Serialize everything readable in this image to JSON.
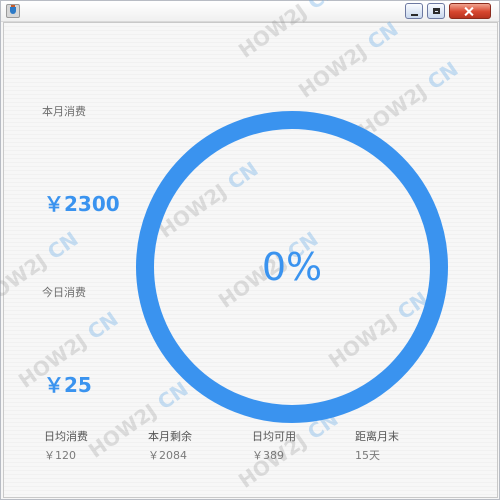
{
  "window": {
    "buttons": {
      "minimize": "minimize",
      "maximize": "maximize",
      "close": "close"
    }
  },
  "watermark": {
    "prefix": "HOW2J",
    "suffix": "CN"
  },
  "stats": {
    "month_spend_label": "本月消费",
    "month_spend_value": "￥2300",
    "today_spend_label": "今日消费",
    "today_spend_value": "￥25"
  },
  "progress": {
    "percent_text": "0%",
    "fraction": 0
  },
  "footer": [
    {
      "label": "日均消费",
      "value": "￥120"
    },
    {
      "label": "本月剩余",
      "value": "￥2084"
    },
    {
      "label": "日均可用",
      "value": "￥389"
    },
    {
      "label": "距离月末",
      "value": "15天"
    }
  ],
  "colors": {
    "accent": "#3a93ef",
    "ring": "#3a93ef"
  }
}
